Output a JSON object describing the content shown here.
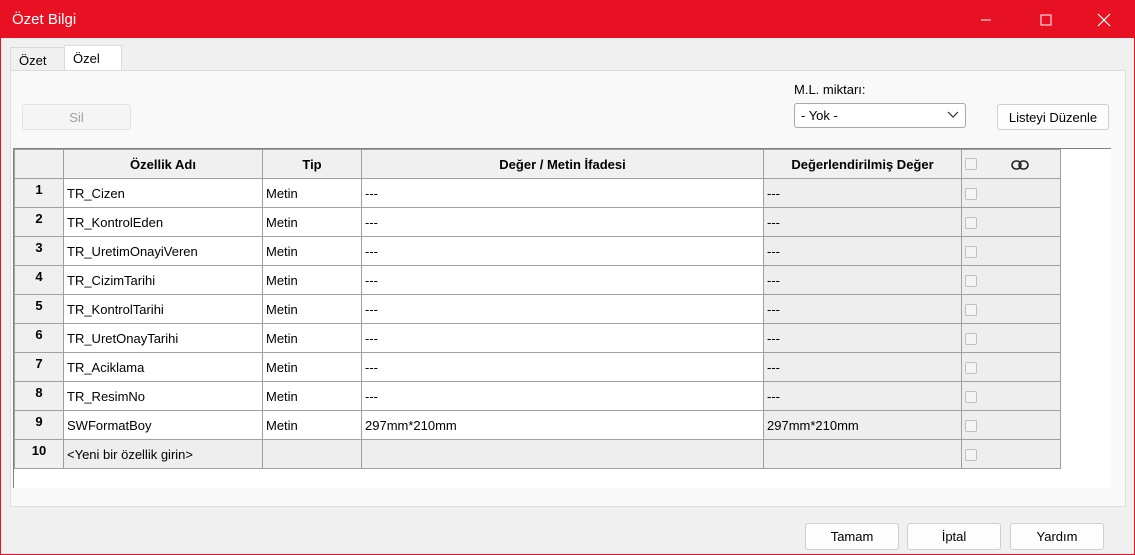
{
  "window": {
    "title": "Özet Bilgi"
  },
  "tabs": [
    {
      "label": "Özet"
    },
    {
      "label": "Özel"
    }
  ],
  "toolbar": {
    "delete_label": "Sil",
    "ml_label": "M.L. miktarı:",
    "ml_value": "- Yok -",
    "edit_list_label": "Listeyi Düzenle"
  },
  "grid": {
    "headers": {
      "name": "Özellik Adı",
      "type": "Tip",
      "value": "Değer / Metin İfadesi",
      "evaluated": "Değerlendirilmiş Değer"
    },
    "rows": [
      {
        "num": "1",
        "name": "TR_Cizen",
        "type": "Metin",
        "value": "---",
        "evaluated": "---"
      },
      {
        "num": "2",
        "name": "TR_KontrolEden",
        "type": "Metin",
        "value": "---",
        "evaluated": "---"
      },
      {
        "num": "3",
        "name": "TR_UretimOnayiVeren",
        "type": "Metin",
        "value": "---",
        "evaluated": "---"
      },
      {
        "num": "4",
        "name": "TR_CizimTarihi",
        "type": "Metin",
        "value": "---",
        "evaluated": "---"
      },
      {
        "num": "5",
        "name": "TR_KontrolTarihi",
        "type": "Metin",
        "value": "---",
        "evaluated": "---"
      },
      {
        "num": "6",
        "name": "TR_UretOnayTarihi",
        "type": "Metin",
        "value": "---",
        "evaluated": "---"
      },
      {
        "num": "7",
        "name": "TR_Aciklama",
        "type": "Metin",
        "value": "---",
        "evaluated": "---"
      },
      {
        "num": "8",
        "name": "TR_ResimNo",
        "type": "Metin",
        "value": "---",
        "evaluated": "---"
      },
      {
        "num": "9",
        "name": "SWFormatBoy",
        "type": "Metin",
        "value": "297mm*210mm",
        "evaluated": "297mm*210mm"
      },
      {
        "num": "10",
        "name": "<Yeni bir özellik girin>",
        "type": "",
        "value": "",
        "evaluated": ""
      }
    ]
  },
  "footer": {
    "ok_label": "Tamam",
    "cancel_label": "İptal",
    "help_label": "Yardım"
  },
  "colors": {
    "titlebar": "#e81123"
  }
}
